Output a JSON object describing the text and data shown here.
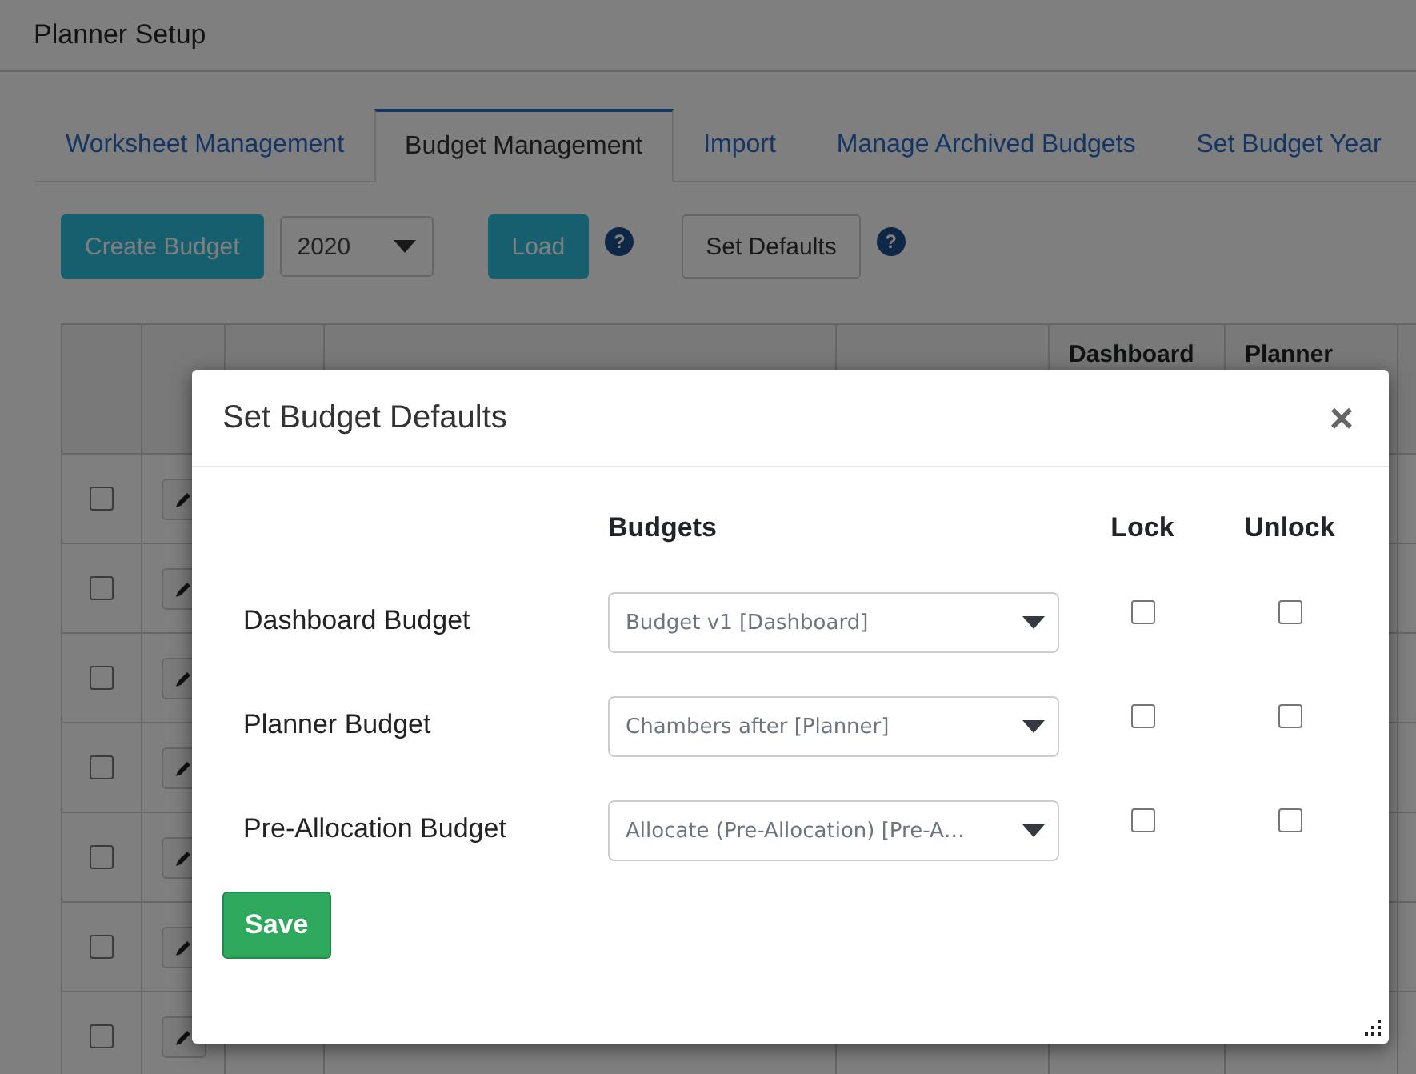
{
  "page": {
    "title": "Planner Setup"
  },
  "tabs": [
    {
      "label": "Worksheet Management",
      "selected": false
    },
    {
      "label": "Budget Management",
      "selected": true
    },
    {
      "label": "Import",
      "selected": false
    },
    {
      "label": "Manage Archived Budgets",
      "selected": false
    },
    {
      "label": "Set Budget Year",
      "selected": false
    }
  ],
  "toolbar": {
    "create_button": "Create Budget",
    "year_select": "2020",
    "load_button": "Load",
    "help_mark": "?",
    "defaults_button": "Set Defaults"
  },
  "table": {
    "columns": [
      "",
      "",
      "",
      "",
      "",
      "Dashboard",
      "Planner",
      ""
    ],
    "rows": [
      {
        "checked": false
      },
      {
        "checked": false
      },
      {
        "checked": false
      },
      {
        "checked": false
      },
      {
        "checked": false
      },
      {
        "checked": false
      },
      {
        "checked": false
      }
    ]
  },
  "dialog": {
    "title": "Set Budget Defaults",
    "close": "×",
    "headers": [
      "Budgets",
      "Lock",
      "Unlock"
    ],
    "rows": [
      {
        "label": "Dashboard Budget",
        "value": "Budget v1 [Dashboard]",
        "lock": false,
        "unlock": false
      },
      {
        "label": "Planner Budget",
        "value": "Chambers after [Planner]",
        "lock": false,
        "unlock": false
      },
      {
        "label": "Pre-Allocation Budget",
        "value": "Allocate (Pre-Allocation) [Pre-A…",
        "lock": false,
        "unlock": false
      }
    ],
    "save_button": "Save"
  }
}
